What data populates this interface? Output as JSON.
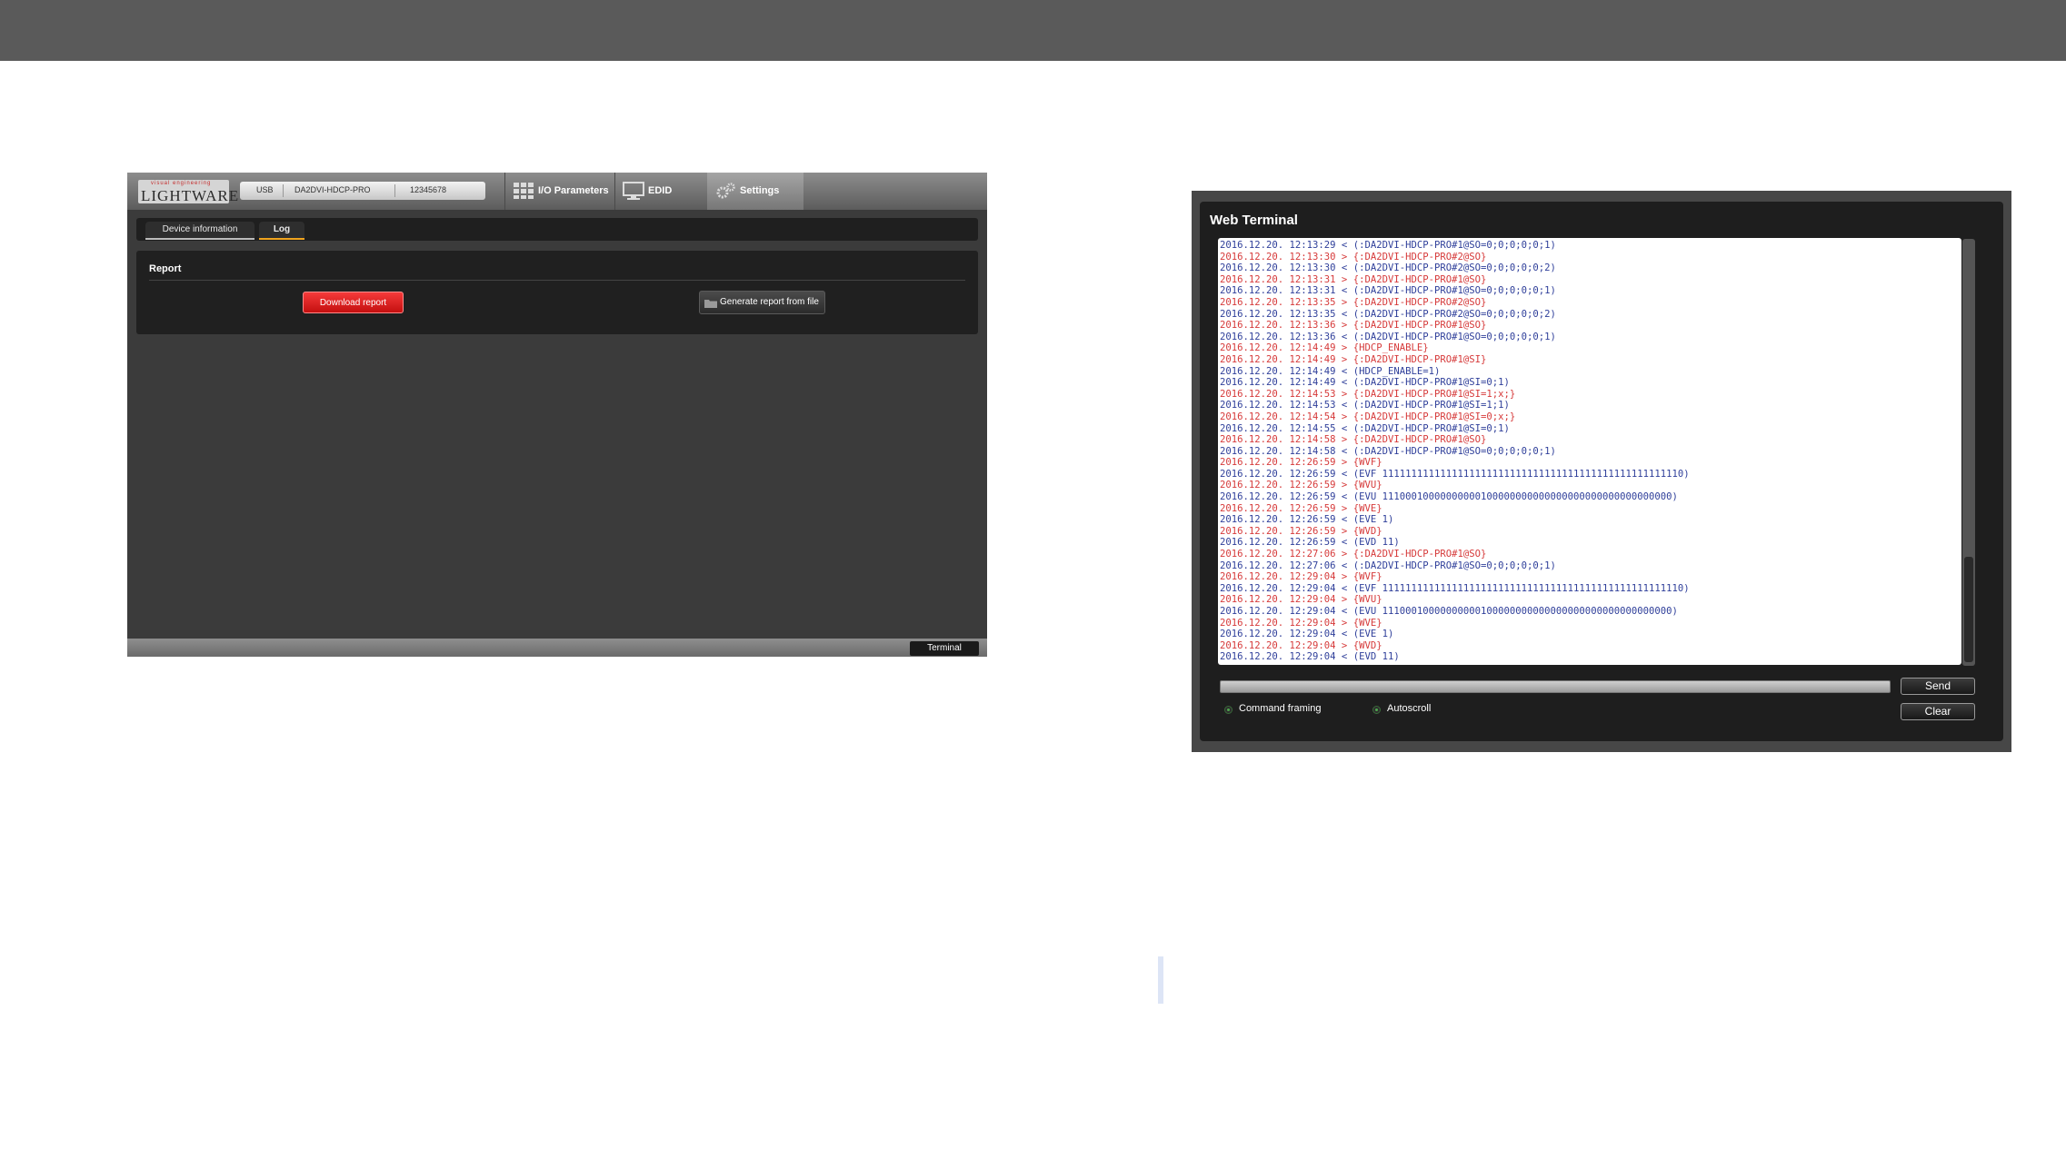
{
  "lightware_app": {
    "logo_text": "LIGHTWARE",
    "logo_tagline": "visual engineering",
    "connection": {
      "type": "USB",
      "model": "DA2DVI-HDCP-PRO",
      "serial": "12345678"
    },
    "top_tabs": {
      "io_parameters": "I/O Parameters",
      "edid": "EDID",
      "settings": "Settings"
    },
    "sub_tabs": {
      "device_information": "Device information",
      "log": "Log"
    },
    "report": {
      "title": "Report",
      "download_button": "Download report",
      "generate_button": "Generate report from file"
    },
    "terminal_button": "Terminal",
    "colors": {
      "download_red": "#e01b1b",
      "active_tab_underline": "#f0a41e"
    }
  },
  "web_terminal": {
    "title": "Web Terminal",
    "log": [
      {
        "dir": "in",
        "text": "2016.12.20. 12:13:29 < (:DA2DVI-HDCP-PRO#1@SO=0;0;0;0;0;1)"
      },
      {
        "dir": "out",
        "text": "2016.12.20. 12:13:30 > {:DA2DVI-HDCP-PRO#2@SO}"
      },
      {
        "dir": "in",
        "text": "2016.12.20. 12:13:30 < (:DA2DVI-HDCP-PRO#2@SO=0;0;0;0;0;2)"
      },
      {
        "dir": "out",
        "text": "2016.12.20. 12:13:31 > {:DA2DVI-HDCP-PRO#1@SO}"
      },
      {
        "dir": "in",
        "text": "2016.12.20. 12:13:31 < (:DA2DVI-HDCP-PRO#1@SO=0;0;0;0;0;1)"
      },
      {
        "dir": "out",
        "text": "2016.12.20. 12:13:35 > {:DA2DVI-HDCP-PRO#2@SO}"
      },
      {
        "dir": "in",
        "text": "2016.12.20. 12:13:35 < (:DA2DVI-HDCP-PRO#2@SO=0;0;0;0;0;2)"
      },
      {
        "dir": "out",
        "text": "2016.12.20. 12:13:36 > {:DA2DVI-HDCP-PRO#1@SO}"
      },
      {
        "dir": "in",
        "text": "2016.12.20. 12:13:36 < (:DA2DVI-HDCP-PRO#1@SO=0;0;0;0;0;1)"
      },
      {
        "dir": "out",
        "text": "2016.12.20. 12:14:49 > {HDCP_ENABLE}"
      },
      {
        "dir": "out",
        "text": "2016.12.20. 12:14:49 > {:DA2DVI-HDCP-PRO#1@SI}"
      },
      {
        "dir": "in",
        "text": "2016.12.20. 12:14:49 < (HDCP_ENABLE=1)"
      },
      {
        "dir": "in",
        "text": "2016.12.20. 12:14:49 < (:DA2DVI-HDCP-PRO#1@SI=0;1)"
      },
      {
        "dir": "out",
        "text": "2016.12.20. 12:14:53 > {:DA2DVI-HDCP-PRO#1@SI=1;x;}"
      },
      {
        "dir": "in",
        "text": "2016.12.20. 12:14:53 < (:DA2DVI-HDCP-PRO#1@SI=1;1)"
      },
      {
        "dir": "out",
        "text": "2016.12.20. 12:14:54 > {:DA2DVI-HDCP-PRO#1@SI=0;x;}"
      },
      {
        "dir": "in",
        "text": "2016.12.20. 12:14:55 < (:DA2DVI-HDCP-PRO#1@SI=0;1)"
      },
      {
        "dir": "out",
        "text": "2016.12.20. 12:14:58 > {:DA2DVI-HDCP-PRO#1@SO}"
      },
      {
        "dir": "in",
        "text": "2016.12.20. 12:14:58 < (:DA2DVI-HDCP-PRO#1@SO=0;0;0;0;0;1)"
      },
      {
        "dir": "out",
        "text": "2016.12.20. 12:26:59 > {WVF}"
      },
      {
        "dir": "in",
        "text": "2016.12.20. 12:26:59 < (EVF 1111111111111111111111111111111111111111111111111110)"
      },
      {
        "dir": "out",
        "text": "2016.12.20. 12:26:59 > {WVU}"
      },
      {
        "dir": "in",
        "text": "2016.12.20. 12:26:59 < (EVU 11100010000000000100000000000000000000000000000000)"
      },
      {
        "dir": "out",
        "text": "2016.12.20. 12:26:59 > {WVE}"
      },
      {
        "dir": "in",
        "text": "2016.12.20. 12:26:59 < (EVE 1)"
      },
      {
        "dir": "out",
        "text": "2016.12.20. 12:26:59 > {WVD}"
      },
      {
        "dir": "in",
        "text": "2016.12.20. 12:26:59 < (EVD 11)"
      },
      {
        "dir": "out",
        "text": "2016.12.20. 12:27:06 > {:DA2DVI-HDCP-PRO#1@SO}"
      },
      {
        "dir": "in",
        "text": "2016.12.20. 12:27:06 < (:DA2DVI-HDCP-PRO#1@SO=0;0;0;0;0;1)"
      },
      {
        "dir": "out",
        "text": "2016.12.20. 12:29:04 > {WVF}"
      },
      {
        "dir": "in",
        "text": "2016.12.20. 12:29:04 < (EVF 1111111111111111111111111111111111111111111111111110)"
      },
      {
        "dir": "out",
        "text": "2016.12.20. 12:29:04 > {WVU}"
      },
      {
        "dir": "in",
        "text": "2016.12.20. 12:29:04 < (EVU 11100010000000000100000000000000000000000000000000)"
      },
      {
        "dir": "out",
        "text": "2016.12.20. 12:29:04 > {WVE}"
      },
      {
        "dir": "in",
        "text": "2016.12.20. 12:29:04 < (EVE 1)"
      },
      {
        "dir": "out",
        "text": "2016.12.20. 12:29:04 > {WVD}"
      },
      {
        "dir": "in",
        "text": "2016.12.20. 12:29:04 < (EVD 11)"
      }
    ],
    "command_input": {
      "value": ""
    },
    "send_button": "Send",
    "clear_button": "Clear",
    "options": {
      "command_framing": "Command framing",
      "autoscroll": "Autoscroll"
    },
    "colors": {
      "incoming": "#2f3f9a",
      "outgoing": "#d63a3a"
    }
  }
}
